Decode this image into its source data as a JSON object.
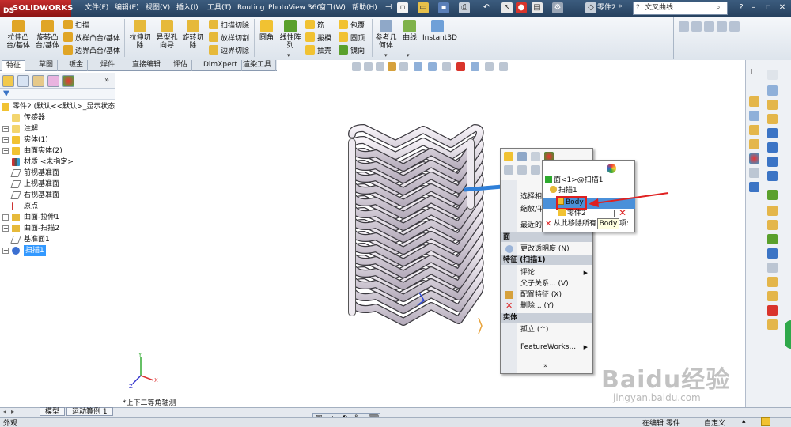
{
  "app": {
    "brand": "SOLIDWORKS",
    "ds": "DS",
    "doc_name": "零件2 *",
    "search_placeholder": "文叉曲线"
  },
  "menu": [
    "文件(F)",
    "编辑(E)",
    "视图(V)",
    "插入(I)",
    "工具(T)",
    "Routing",
    "PhotoView 360",
    "窗口(W)",
    "帮助(H)"
  ],
  "commands": {
    "extrude_boss": "拉伸凸台/基体",
    "revolve_boss": "旋转凸台/基体",
    "sweep": "扫描",
    "loft": "放样凸台/基体",
    "boundary": "边界凸台/基体",
    "extrude_cut": "拉伸切除",
    "hole_wizard": "异型孔向导",
    "revolve_cut": "旋转切除",
    "swept_cut": "扫描切除",
    "lofted_cut": "放样切割",
    "boundary_cut": "边界切除",
    "fillet": "圆角",
    "linear_pattern": "线性阵列",
    "rib": "筋",
    "draft": "拔模",
    "shell": "抽壳",
    "wrap": "包覆",
    "dome": "圆顶",
    "mirror": "镜向",
    "ref_geometry": "参考几何体",
    "curves": "曲线",
    "instant3d": "Instant3D"
  },
  "tabs": [
    "特征",
    "草图",
    "钣金",
    "焊件",
    "直接编辑",
    "评估",
    "DimXpert",
    "渲染工具"
  ],
  "tree": {
    "root": "零件2 (默认<<默认>_显示状态",
    "items": [
      {
        "label": "传感器",
        "expand": ""
      },
      {
        "label": "注解",
        "expand": "+"
      },
      {
        "label": "实体(1)",
        "expand": "+"
      },
      {
        "label": "曲面实体(2)",
        "expand": "+"
      },
      {
        "label": "材质 <未指定>",
        "expand": ""
      },
      {
        "label": "前视基准面",
        "expand": ""
      },
      {
        "label": "上视基准面",
        "expand": ""
      },
      {
        "label": "右视基准面",
        "expand": ""
      },
      {
        "label": "原点",
        "expand": ""
      },
      {
        "label": "曲面-拉伸1",
        "expand": "+"
      },
      {
        "label": "曲面-扫描2",
        "expand": "+"
      },
      {
        "label": "基准面1",
        "expand": ""
      },
      {
        "label": "扫描1",
        "expand": "+"
      }
    ]
  },
  "context_menu": {
    "items_top": [
      "选择相",
      "缩放/平",
      "最近的"
    ],
    "section_face": "面",
    "change_transparency": "更改透明度 (N)",
    "section_feature": "特征 (扫描1)",
    "comment": "评论",
    "parent_child": "父子关系... (V)",
    "config_feature": "配置特征 (X)",
    "delete": "删除... (Y)",
    "section_body": "实体",
    "isolate": "孤立 (^)",
    "featureworks": "FeatureWorks...",
    "more": "»"
  },
  "selection_popup": {
    "face": "面<1>@扫描1",
    "sweep": "扫描1",
    "body": "Body",
    "part": "零件2",
    "remove": "从此移除所有",
    "remove_tail": "项:"
  },
  "tooltip": "Body",
  "view_label": "*上下二等角轴测",
  "bottom_tabs": [
    "模型",
    "运动算例 1"
  ],
  "status": {
    "left": "外观",
    "editing": "在编辑 零件",
    "custom": "自定义"
  },
  "watermark": {
    "main": "Baidu经验",
    "sub": "jingyan.baidu.com"
  },
  "colors": {
    "accent": "#3399ff",
    "highlight_box": "#e02020",
    "arrow": "#e02020",
    "title_bg": "#2f4b6c"
  }
}
